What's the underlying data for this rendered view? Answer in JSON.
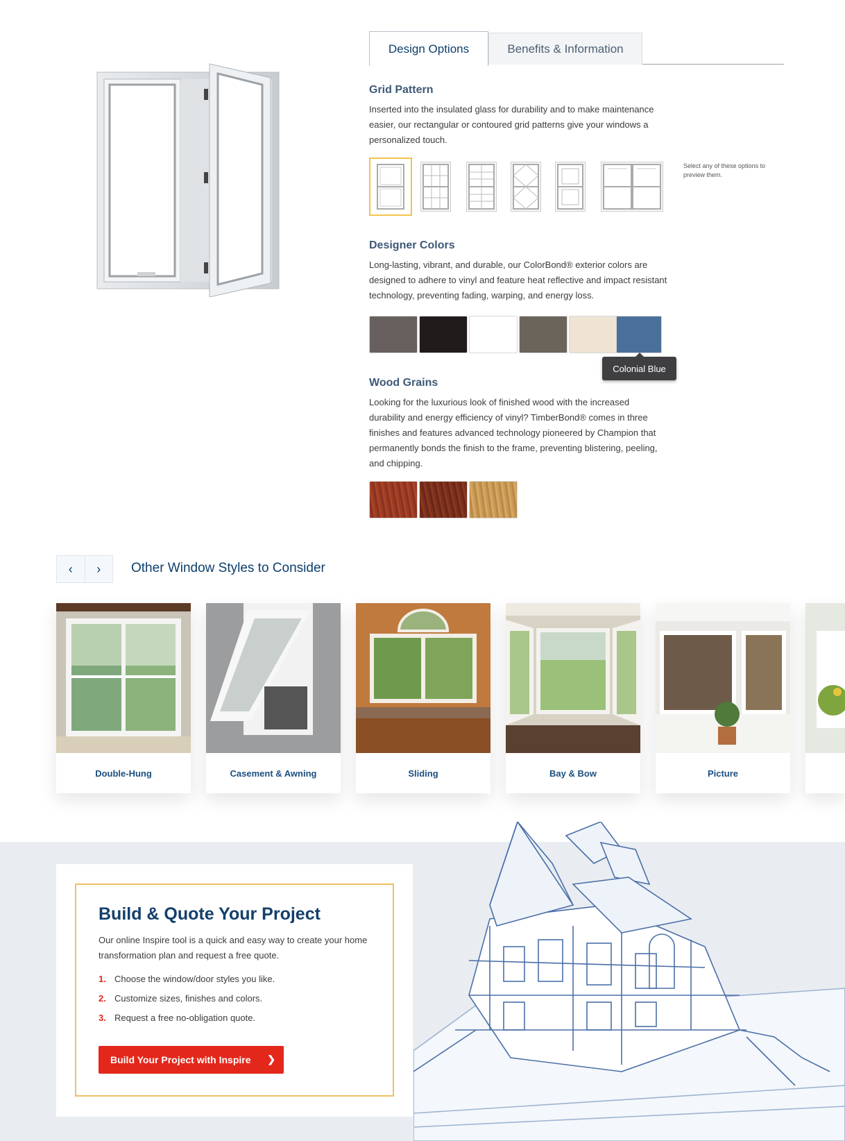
{
  "tabs": [
    {
      "label": "Design Options",
      "active": true
    },
    {
      "label": "Benefits & Information",
      "active": false
    }
  ],
  "grid_pattern": {
    "title": "Grid Pattern",
    "description": "Inserted into the insulated glass for durability and to make maintenance easier, our rectangular or contoured grid patterns give your windows a personalized touch.",
    "options": [
      "no-grid-icon",
      "colonial-grid-icon",
      "prairie-grid-icon",
      "diamond-grid-icon",
      "perimeter-grid-icon",
      "twin-window-grid-icon"
    ],
    "selected_index": 0,
    "hint": "Select any of these options to preview them."
  },
  "designer_colors": {
    "title": "Designer Colors",
    "description": "Long-lasting, vibrant, and durable, our ColorBond® exterior colors are designed to adhere to vinyl and feature heat reflective and impact resistant technology, preventing fading, warping, and energy loss.",
    "swatches": [
      "#67605f",
      "#221b1b",
      "#ffffff",
      "#6a645a",
      "#efe3d3",
      "#4a7099"
    ],
    "tooltip": "Colonial Blue"
  },
  "wood_grains": {
    "title": "Wood Grains",
    "description": "Looking for the luxurious look of finished wood with the increased durability and energy efficiency of vinyl? TimberBond® comes in three finishes and features advanced technology pioneered by Champion that permanently bonds the finish to the frame, preventing blistering, peeling, and chipping.",
    "swatches": [
      "#9b3a22",
      "#7a2f1c",
      "#c99a55"
    ]
  },
  "other_styles": {
    "title": "Other Window Styles to Consider",
    "prev_icon": "chevron-left-icon",
    "next_icon": "chevron-right-icon",
    "cards": [
      {
        "label": "Double-Hung"
      },
      {
        "label": "Casement & Awning"
      },
      {
        "label": "Sliding"
      },
      {
        "label": "Bay & Bow"
      },
      {
        "label": "Picture"
      }
    ]
  },
  "build_quote": {
    "title": "Build & Quote Your Project",
    "description": "Our online Inspire tool is a quick and easy way to create your home transformation plan and request a free quote.",
    "steps": [
      {
        "num": "1.",
        "text": "Choose the window/door styles you like."
      },
      {
        "num": "2.",
        "text": "Customize sizes, finishes and colors."
      },
      {
        "num": "3.",
        "text": "Request a free no-obligation quote."
      }
    ],
    "cta_label": "Build Your Project with Inspire"
  },
  "colors": {
    "brand_navy": "#0d3f6b",
    "accent_red": "#e3281b",
    "accent_gold": "#f0c061"
  }
}
